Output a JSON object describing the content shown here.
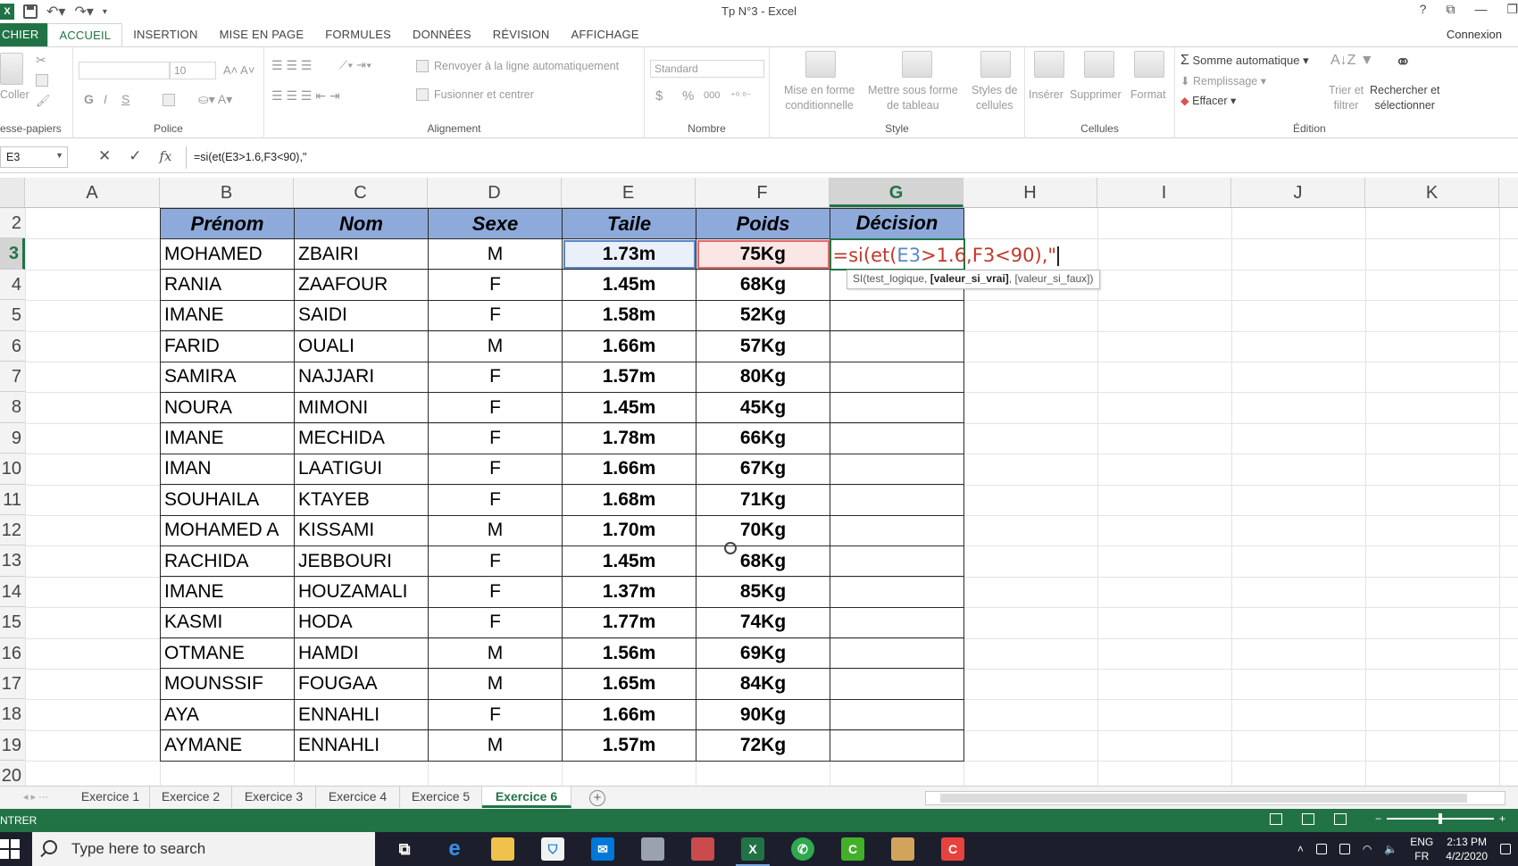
{
  "window": {
    "title": "Tp N°3 - Excel",
    "help": "?",
    "signin": "Connexion"
  },
  "ribbon_tabs": [
    {
      "label": "CHIER",
      "state": "file"
    },
    {
      "label": "ACCUEIL",
      "state": "active"
    },
    {
      "label": "INSERTION",
      "state": ""
    },
    {
      "label": "MISE EN PAGE",
      "state": ""
    },
    {
      "label": "FORMULES",
      "state": ""
    },
    {
      "label": "DONNÉES",
      "state": ""
    },
    {
      "label": "RÉVISION",
      "state": ""
    },
    {
      "label": "AFFICHAGE",
      "state": ""
    }
  ],
  "ribbon": {
    "clipboard": {
      "paste": "Coller",
      "group": "esse-papiers"
    },
    "font": {
      "size": "10",
      "bold": "G",
      "italic": "I",
      "underline": "S",
      "group": "Police"
    },
    "alignment": {
      "wrap": "Renvoyer à la ligne automatiquement",
      "merge": "Fusionner et centrer",
      "group": "Alignement"
    },
    "number": {
      "format": "Standard",
      "currency": "$",
      "percent": "%",
      "thousands": "000",
      "group": "Nombre"
    },
    "styles": {
      "conditional": [
        "Mise en forme",
        "conditionnelle"
      ],
      "table": [
        "Mettre sous forme",
        "de tableau"
      ],
      "cell": [
        "Styles de",
        "cellules"
      ],
      "group": "Style"
    },
    "cells": {
      "insert": "Insérer",
      "delete": "Supprimer",
      "format": "Format",
      "group": "Cellules"
    },
    "editing": {
      "autosum": "Somme automatique",
      "fill": "Remplissage",
      "clear": "Effacer",
      "sort": [
        "Trier et",
        "filtrer"
      ],
      "find": [
        "Rechercher et",
        "sélectionner"
      ],
      "group": "Édition"
    }
  },
  "formula_bar": {
    "name_box": "E3",
    "formula": "=si(et(E3>1.6,F3<90),\""
  },
  "columns": [
    "A",
    "B",
    "C",
    "D",
    "E",
    "F",
    "G",
    "H",
    "I",
    "J",
    "K"
  ],
  "selected_column": "G",
  "rows": [
    "2",
    "3",
    "4",
    "5",
    "6",
    "7",
    "8",
    "9",
    "10",
    "11",
    "12",
    "13",
    "14",
    "15",
    "16",
    "17",
    "18",
    "19",
    "20"
  ],
  "selected_row": "3",
  "table": {
    "headers": [
      "Prénom",
      "Nom",
      "Sexe",
      "Taile",
      "Poids",
      "Décision"
    ],
    "rows": [
      [
        "MOHAMED",
        "ZBAIRI",
        "M",
        "1.73m",
        "75Kg"
      ],
      [
        "RANIA",
        "ZAAFOUR",
        "F",
        "1.45m",
        "68Kg"
      ],
      [
        "IMANE",
        "SAIDI",
        "F",
        "1.58m",
        "52Kg"
      ],
      [
        "FARID",
        "OUALI",
        "M",
        "1.66m",
        "57Kg"
      ],
      [
        "SAMIRA",
        "NAJJARI",
        "F",
        "1.57m",
        "80Kg"
      ],
      [
        "NOURA",
        "MIMONI",
        "F",
        "1.45m",
        "45Kg"
      ],
      [
        "IMANE",
        "MECHIDA",
        "F",
        "1.78m",
        "66Kg"
      ],
      [
        "IMAN",
        "LAATIGUI",
        "F",
        "1.66m",
        "67Kg"
      ],
      [
        "SOUHAILA",
        "KTAYEB",
        "F",
        "1.68m",
        "71Kg"
      ],
      [
        "MOHAMED A",
        "KISSAMI",
        "M",
        "1.70m",
        "70Kg"
      ],
      [
        "RACHIDA",
        "JEBBOURI",
        "F",
        "1.45m",
        "68Kg"
      ],
      [
        "IMANE",
        "HOUZAMALI",
        "F",
        "1.37m",
        "85Kg"
      ],
      [
        "KASMI",
        "HODA",
        "F",
        "1.77m",
        "74Kg"
      ],
      [
        "OTMANE",
        "HAMDI",
        "M",
        "1.56m",
        "69Kg"
      ],
      [
        "MOUNSSIF",
        "FOUGAA",
        "M",
        "1.65m",
        "84Kg"
      ],
      [
        "AYA",
        "ENNAHLI",
        "F",
        "1.66m",
        "90Kg"
      ],
      [
        "AYMANE",
        "ENNAHLI",
        "M",
        "1.57m",
        "72Kg"
      ]
    ]
  },
  "cell_edit": {
    "prefix": "=si(et(",
    "ref1": "E3",
    "mid": ">1.6,",
    "ref2": "F3",
    "suffix": "<90),\""
  },
  "tooltip": {
    "func": "SI(test_logique, ",
    "current": "[valeur_si_vrai]",
    "rest": ", [valeur_si_faux])"
  },
  "sheets": [
    "Exercice 1",
    "Exercice 2",
    "Exercice 3",
    "Exercice 4",
    "Exercice 5",
    "Exercice 6"
  ],
  "active_sheet": "Exercice 6",
  "status": {
    "mode": "NTRER"
  },
  "taskbar": {
    "search_placeholder": "Type here to search",
    "lang_top": "ENG",
    "lang_bottom": "FR",
    "time": "2:13 PM",
    "date": "4/2/2020"
  },
  "colors": {
    "excel_green": "#217346",
    "table_header": "#8eaadb",
    "ref_blue": "#5b87c9",
    "ref_red": "#e06a6a"
  }
}
